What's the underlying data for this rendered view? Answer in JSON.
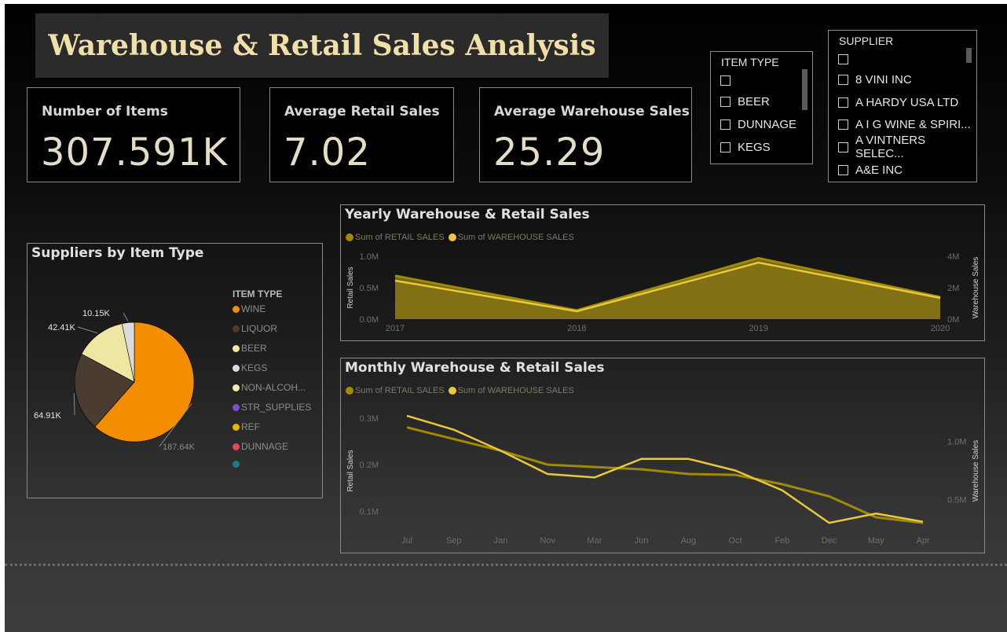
{
  "title": "Warehouse & Retail Sales Analysis",
  "kpis": [
    {
      "label": "Number of Items",
      "value": "307.591K"
    },
    {
      "label": "Average Retail Sales",
      "value": "7.02"
    },
    {
      "label": "Average Warehouse Sales",
      "value": "25.29"
    }
  ],
  "item_type_slicer": {
    "header": "ITEM TYPE",
    "items": [
      "",
      "BEER",
      "DUNNAGE",
      "KEGS"
    ]
  },
  "supplier_slicer": {
    "header": "SUPPLIER",
    "items": [
      "",
      "8 VINI INC",
      "A HARDY USA LTD",
      "A I G WINE & SPIRI...",
      "A VINTNERS SELEC...",
      "A&E INC"
    ]
  },
  "pie_panel": {
    "title": "Suppliers by Item Type",
    "legend_title": "ITEM TYPE",
    "legend": [
      {
        "label": "WINE",
        "color": "#f28e00"
      },
      {
        "label": "LIQUOR",
        "color": "#4a3c30"
      },
      {
        "label": "BEER",
        "color": "#f0e6a4"
      },
      {
        "label": "KEGS",
        "color": "#dcdcdc"
      },
      {
        "label": "NON-ALCOH...",
        "color": "#f5e9b2"
      },
      {
        "label": "STR_SUPPLIES",
        "color": "#7a4fd0"
      },
      {
        "label": "REF",
        "color": "#e2b800"
      },
      {
        "label": "DUNNAGE",
        "color": "#e04858"
      },
      {
        "label": "",
        "color": "#1e7b86"
      }
    ],
    "slice_labels": [
      "187.64K",
      "64.91K",
      "42.41K",
      "10.15K"
    ]
  },
  "yearly_panel": {
    "title": "Yearly Warehouse & Retail Sales",
    "legend": [
      {
        "label": "Sum of RETAIL SALES",
        "color": "#a08a00"
      },
      {
        "label": "Sum of WAREHOUSE SALES",
        "color": "#e8c83c"
      }
    ],
    "left_axis_label": "Retail Sales",
    "right_axis_label": "Warehouse Sales",
    "left_ticks": [
      "1.0M",
      "0.5M",
      "0.0M"
    ],
    "right_ticks": [
      "4M",
      "2M",
      "0M"
    ],
    "x_labels": [
      "2017",
      "2018",
      "2019",
      "2020"
    ]
  },
  "monthly_panel": {
    "title": "Monthly Warehouse & Retail Sales",
    "legend": [
      {
        "label": "Sum of RETAIL SALES",
        "color": "#a08a00"
      },
      {
        "label": "Sum of WAREHOUSE SALES",
        "color": "#e8c83c"
      }
    ],
    "left_axis_label": "Retail Sales",
    "right_axis_label": "Warehouse Sales",
    "left_ticks": [
      "0.3M",
      "0.2M",
      "0.1M"
    ],
    "right_ticks": [
      "1.0M",
      "0.5M"
    ],
    "x_labels": [
      "Jul",
      "Sep",
      "Jan",
      "Nov",
      "Mar",
      "Jun",
      "Aug",
      "Oct",
      "Feb",
      "Dec",
      "May",
      "Apr"
    ]
  },
  "chart_data": [
    {
      "type": "pie",
      "title": "Suppliers by Item Type",
      "categories": [
        "WINE",
        "LIQUOR",
        "BEER",
        "KEGS"
      ],
      "values": [
        187640,
        64910,
        42410,
        10150
      ],
      "colors": [
        "#f28e00",
        "#4a3c30",
        "#f0e6a4",
        "#dcdcdc"
      ]
    },
    {
      "type": "area",
      "title": "Yearly Warehouse & Retail Sales",
      "categories": [
        "2017",
        "2018",
        "2019",
        "2020"
      ],
      "series": [
        {
          "name": "Sum of RETAIL SALES",
          "axis": "left",
          "values": [
            0.69,
            0.14,
            0.97,
            0.35
          ]
        },
        {
          "name": "Sum of WAREHOUSE SALES",
          "axis": "right",
          "values": [
            2.45,
            0.5,
            3.6,
            1.35
          ]
        }
      ],
      "ylim_left": [
        0,
        1.0
      ],
      "ylim_right": [
        0,
        4
      ]
    },
    {
      "type": "line",
      "title": "Monthly Warehouse & Retail Sales",
      "categories": [
        "Jul",
        "Sep",
        "Jan",
        "Nov",
        "Mar",
        "Jun",
        "Aug",
        "Oct",
        "Feb",
        "Dec",
        "May",
        "Apr"
      ],
      "series": [
        {
          "name": "Sum of RETAIL SALES",
          "axis": "left",
          "values": [
            0.28,
            0.255,
            0.23,
            0.2,
            0.195,
            0.19,
            0.18,
            0.178,
            0.158,
            0.132,
            0.087,
            0.075
          ]
        },
        {
          "name": "Sum of WAREHOUSE SALES",
          "axis": "right",
          "values": [
            1.22,
            1.1,
            0.92,
            0.72,
            0.69,
            0.85,
            0.85,
            0.75,
            0.58,
            0.3,
            0.38,
            0.31
          ]
        }
      ],
      "ylim_left": [
        0.05,
        0.32
      ],
      "ylim_right": [
        0.2,
        1.28
      ]
    }
  ]
}
